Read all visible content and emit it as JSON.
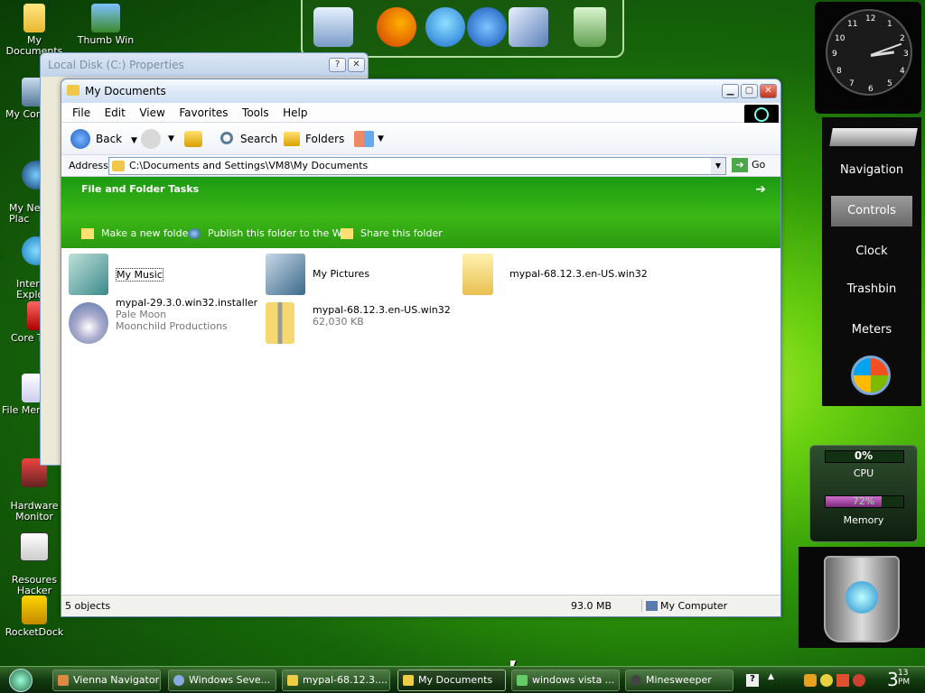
{
  "desktop_icons": [
    {
      "label": "My Documents",
      "icon": "folder-icon"
    },
    {
      "label": "Thumb Win",
      "icon": "picture-icon"
    },
    {
      "label": "My Com",
      "icon": "computer-icon"
    },
    {
      "label": "My Net\nPlac",
      "icon": "network-icon"
    },
    {
      "label": "Interi\nExplo",
      "icon": "ie-icon"
    },
    {
      "label": "Core T",
      "icon": "app-icon"
    },
    {
      "label": "File Menu",
      "icon": "document-icon"
    },
    {
      "label": "Hardware\nMonitor",
      "icon": "monitor-icon"
    },
    {
      "label": "Resoures\nHacker",
      "icon": "hacker-icon"
    },
    {
      "label": "RocketDock",
      "icon": "rocketdock-icon"
    }
  ],
  "dock": [
    "computer-icon",
    "firefox-icon",
    "ie-icon",
    "media-player-icon",
    "desktop-icon",
    "recycle-bin-icon"
  ],
  "clock": {
    "numbers": [
      "12",
      "1",
      "2",
      "3",
      "4",
      "5",
      "6",
      "7",
      "8",
      "9",
      "10",
      "11"
    ]
  },
  "nav_panel": {
    "items": [
      "Navigation",
      "Controls",
      "Clock",
      "Trashbin",
      "Meters"
    ]
  },
  "meters": {
    "cpu_text": "0%",
    "cpu_label": "CPU",
    "cpu_level": 0,
    "mem_text": "72%",
    "mem_label": "Memory",
    "mem_level": 0.72
  },
  "props_window": {
    "title": "Local Disk (C:) Properties",
    "help_label": "?",
    "close_label": "✕"
  },
  "window": {
    "title": "My Documents",
    "min_label": "▁",
    "max_label": "▢",
    "close_label": "✕",
    "menu": [
      "File",
      "Edit",
      "View",
      "Favorites",
      "Tools",
      "Help"
    ],
    "toolbar": {
      "back": "Back",
      "search": "Search",
      "folders": "Folders"
    },
    "address": {
      "label": "Address",
      "path": "C:\\Documents and Settings\\VM8\\My Documents",
      "go": "Go"
    },
    "tasks": {
      "header": "File and Folder Tasks",
      "items": [
        "Make a new folder",
        "Publish this folder to the Web",
        "Share this folder"
      ]
    },
    "items": [
      {
        "name": "My Music",
        "sub1": "",
        "sub2": ""
      },
      {
        "name": "My Pictures",
        "sub1": "",
        "sub2": ""
      },
      {
        "name": "mypal-68.12.3.en-US.win32",
        "sub1": "",
        "sub2": ""
      },
      {
        "name": "mypal-29.3.0.win32.installer",
        "sub1": "Pale Moon",
        "sub2": "Moonchild Productions"
      },
      {
        "name": "mypal-68.12.3.en-US.win32",
        "sub1": "62,030 KB",
        "sub2": ""
      }
    ],
    "status": {
      "objects": "5 objects",
      "size": "93.0 MB",
      "zone": "My Computer"
    }
  },
  "taskbar": {
    "tasks": [
      "Vienna Navigator",
      "Windows Seve...",
      "mypal-68.12.3....",
      "My Documents",
      "windows vista ...",
      "Minesweeper"
    ],
    "active_task": "My Documents",
    "clock": "3",
    "clock_minutes": "13",
    "clock_ampm": "PM"
  },
  "colors": {
    "accent_green": "#3cb816",
    "titlebar": "#dbe7f6",
    "taskbar": "#123a10"
  }
}
